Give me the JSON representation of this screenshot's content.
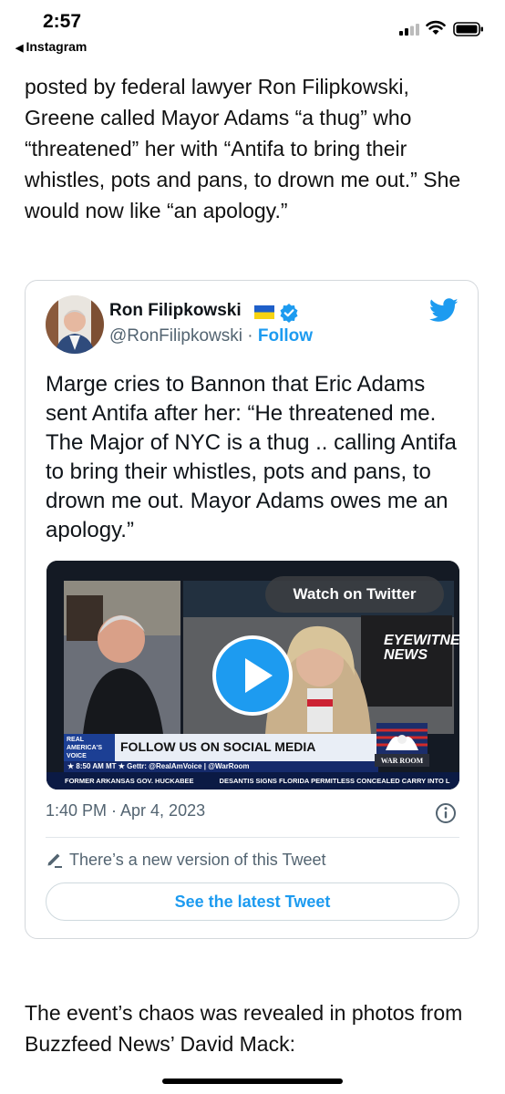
{
  "status_bar": {
    "time": "2:57",
    "back_label": "Instagram"
  },
  "article": {
    "para_before": "posted by federal lawyer Ron Filipkowski, Greene called Mayor Adams “a thug” who “threatened” her with “Antifa to bring their whistles, pots and pans, to drown me out.” She would now like “an apology.”",
    "para_after": "The event’s chaos was revealed in photos from Buzzfeed News’ David Mack:"
  },
  "tweet": {
    "author_name": "Ron Filipkowski",
    "handle": "@RonFilipkowski",
    "separator": "·",
    "follow_label": "Follow",
    "text": "Marge cries to Bannon that Eric Adams sent Antifa after her: “He threatened me. The Major of NYC is a thug .. calling Antifa to bring their whistles, pots and pans, to drown me out. Mayor Adams owes me an apology.”",
    "video": {
      "watch_label": "Watch on Twitter",
      "logo_text": "REAL AMERICA'S VOICE",
      "banner_text": "FOLLOW US ON SOCIAL MEDIA",
      "banner_sub": "★ 8:50 AM MT ★  Gettr: @RealAmVoice | @WarRoom",
      "ticker_left": "FORMER ARKANSAS GOV. HUCKABEE",
      "ticker_right": "DESANTIS SIGNS FLORIDA PERMITLESS CONCEALED CARRY INTO L",
      "eyewitness_text": "EYEWITNESS NEWS",
      "war_room_text": "WAR ROOM"
    },
    "timestamp": "1:40 PM · Apr 4, 2023",
    "new_version_text": "There’s a new version of this Tweet",
    "see_latest_label": "See the latest Tweet"
  },
  "colors": {
    "accent": "#1d9bf0",
    "secondary_text": "#536471"
  }
}
